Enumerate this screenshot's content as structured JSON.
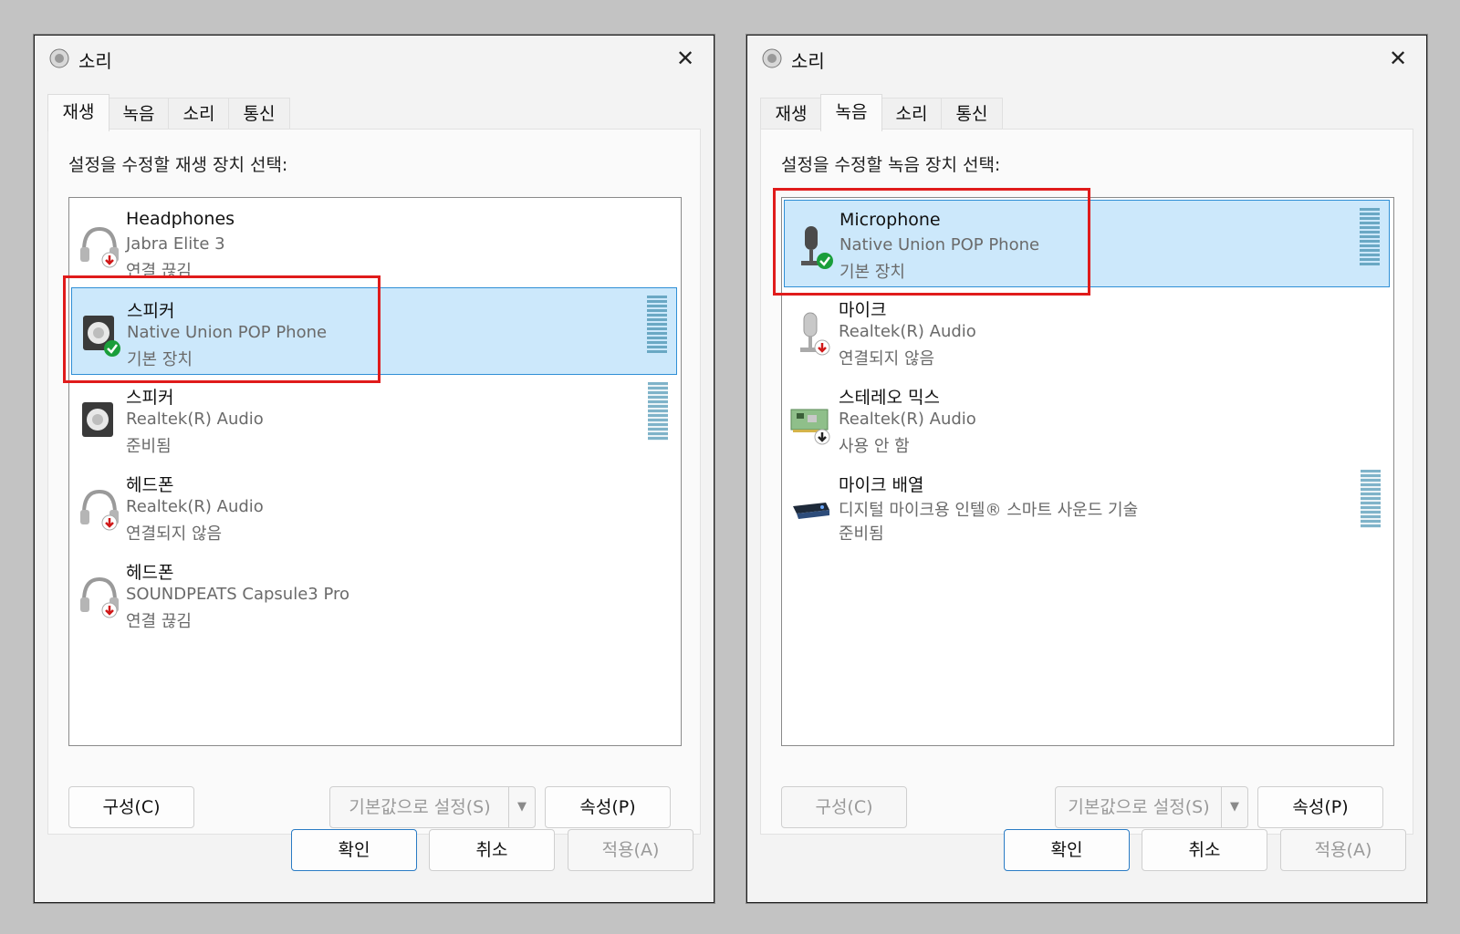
{
  "left": {
    "title": "소리",
    "close": "✕",
    "tabs": [
      "재생",
      "녹음",
      "소리",
      "통신"
    ],
    "active_tab": "재생",
    "instruction": "설정을 수정할 재생 장치 선택:",
    "devices": [
      {
        "name": "Headphones",
        "desc": "Jabra Elite 3",
        "status": "연결 끊김",
        "icon": "headphones-icon",
        "badge": "disconnected-arrow"
      },
      {
        "name": "스피커",
        "desc": "Native Union POP Phone",
        "status": "기본 장치",
        "icon": "speaker-icon",
        "badge": "default-check"
      },
      {
        "name": "스피커",
        "desc": "Realtek(R) Audio",
        "status": "준비됨",
        "icon": "speaker-icon",
        "badge": "none"
      },
      {
        "name": "헤드폰",
        "desc": "Realtek(R) Audio",
        "status": "연결되지 않음",
        "icon": "headphones-icon",
        "badge": "disconnected-arrow"
      },
      {
        "name": "헤드폰",
        "desc": "SOUNDPEATS Capsule3 Pro",
        "status": "연결 끊김",
        "icon": "headphones-icon",
        "badge": "disconnected-arrow"
      }
    ],
    "buttons": {
      "configure": "구성(C)",
      "set_default": "기본값으로 설정(S)",
      "properties": "속성(P)",
      "ok": "확인",
      "cancel": "취소",
      "apply": "적용(A)"
    }
  },
  "right": {
    "title": "소리",
    "close": "✕",
    "tabs": [
      "재생",
      "녹음",
      "소리",
      "통신"
    ],
    "active_tab": "녹음",
    "instruction": "설정을 수정할 녹음 장치 선택:",
    "devices": [
      {
        "name": "Microphone",
        "desc": "Native Union POP Phone",
        "status": "기본 장치",
        "icon": "microphone-icon",
        "badge": "default-check"
      },
      {
        "name": "마이크",
        "desc": "Realtek(R) Audio",
        "status": "연결되지 않음",
        "icon": "microphone-icon",
        "badge": "disconnected-arrow"
      },
      {
        "name": "스테레오 믹스",
        "desc": "Realtek(R) Audio",
        "status": "사용 안 함",
        "icon": "sound-card-icon",
        "badge": "disabled-arrow"
      },
      {
        "name": "마이크 배열",
        "desc": "디지털 마이크용 인텔® 스마트 사운드 기술",
        "status": "준비됨",
        "icon": "mic-array-icon",
        "badge": "none"
      }
    ],
    "buttons": {
      "configure": "구성(C)",
      "set_default": "기본값으로 설정(S)",
      "properties": "속성(P)",
      "ok": "확인",
      "cancel": "취소",
      "apply": "적용(A)"
    }
  },
  "colors": {
    "selection": "#cce8fb",
    "highlight_box": "#e01b1b",
    "check_badge": "#1a9e3a",
    "arrow_badge": "#d01818"
  }
}
